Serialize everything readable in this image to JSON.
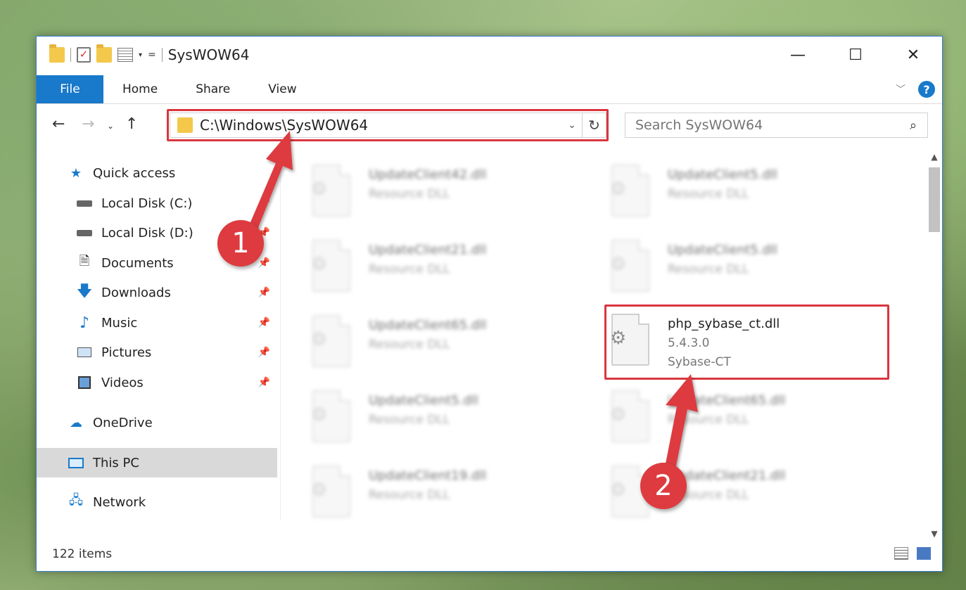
{
  "window": {
    "title": "SysWOW64"
  },
  "controls": {
    "minimize": "—",
    "maximize": "☐",
    "close": "✕"
  },
  "ribbon": {
    "tabs": [
      "File",
      "Home",
      "Share",
      "View"
    ],
    "expand_icon": "chevron-down-icon",
    "help": "?"
  },
  "address": {
    "path": "C:\\Windows\\SysWOW64",
    "search_placeholder": "Search SysWOW64"
  },
  "navpane": {
    "items": [
      {
        "label": "Quick access",
        "icon": "star-icon",
        "pinned": false
      },
      {
        "label": "Local Disk (C:)",
        "icon": "drive-icon",
        "pinned": true
      },
      {
        "label": "Local Disk (D:)",
        "icon": "drive-icon",
        "pinned": true
      },
      {
        "label": "Documents",
        "icon": "document-icon",
        "pinned": true
      },
      {
        "label": "Downloads",
        "icon": "download-icon",
        "pinned": true
      },
      {
        "label": "Music",
        "icon": "music-icon",
        "pinned": true
      },
      {
        "label": "Pictures",
        "icon": "picture-icon",
        "pinned": true
      },
      {
        "label": "Videos",
        "icon": "video-icon",
        "pinned": true
      },
      {
        "label": "OneDrive",
        "icon": "cloud-icon",
        "pinned": false
      },
      {
        "label": "This PC",
        "icon": "computer-icon",
        "pinned": false,
        "selected": true
      },
      {
        "label": "Network",
        "icon": "network-icon",
        "pinned": false
      }
    ]
  },
  "files": [
    {
      "name": "UpdateClient42.dll",
      "line1": "Resource DLL",
      "line2": "",
      "blurred": true
    },
    {
      "name": "UpdateClient5.dll",
      "line1": "Resource DLL",
      "line2": "",
      "blurred": true
    },
    {
      "name": "UpdateClient21.dll",
      "line1": "Resource DLL",
      "line2": "",
      "blurred": true
    },
    {
      "name": "UpdateClient5.dll",
      "line1": "Resource DLL",
      "line2": "",
      "blurred": true
    },
    {
      "name": "UpdateClient65.dll",
      "line1": "Resource DLL",
      "line2": "",
      "blurred": true
    },
    {
      "name": "php_sybase_ct.dll",
      "line1": "5.4.3.0",
      "line2": "Sybase-CT",
      "blurred": false
    },
    {
      "name": "UpdateClient5.dll",
      "line1": "Resource DLL",
      "line2": "",
      "blurred": true
    },
    {
      "name": "UpdateClient65.dll",
      "line1": "Resource DLL",
      "line2": "",
      "blurred": true
    },
    {
      "name": "UpdateClient19.dll",
      "line1": "Resource DLL",
      "line2": "",
      "blurred": true
    },
    {
      "name": "UpdateClient21.dll",
      "line1": "Resource DLL",
      "line2": "",
      "blurred": true
    }
  ],
  "status": {
    "item_count": "122 items"
  },
  "annotations": {
    "step1": "1",
    "step2": "2",
    "color": "#dd3b3f"
  }
}
